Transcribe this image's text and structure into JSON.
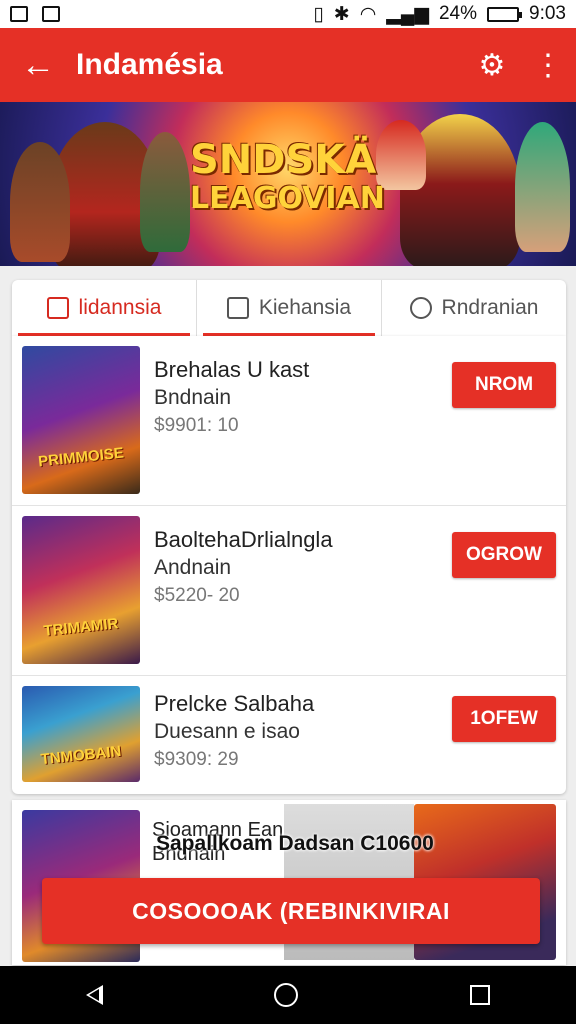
{
  "status_bar": {
    "battery": "24%",
    "time": "9:03"
  },
  "app_bar": {
    "title": "Indamésia"
  },
  "banner": {
    "title_line1": "SNDSKÄ",
    "title_line2": "LEAGOVIAN"
  },
  "tabs": [
    {
      "label": "lidannsia"
    },
    {
      "label": "Kiehansia"
    },
    {
      "label": "Rndranian"
    }
  ],
  "items": [
    {
      "name": "Brehalas U kast",
      "sub": "Bndnain",
      "price": "$9901: 10",
      "button": "NROM",
      "thumb_label": "PRIMMOISE"
    },
    {
      "name": "BaoltehaDrlialngla",
      "sub": "Andnain",
      "price": "$5220- 20",
      "button": "OGROW",
      "thumb_label": "TRIMAMIR"
    },
    {
      "name": "Prelcke Salbaha",
      "sub": "Duesann e isao",
      "price": "$9309: 29",
      "button": "1OFEW",
      "thumb_label": "TNMOBAIN"
    }
  ],
  "promo": {
    "name": "Sioamann Ean",
    "sub": "Bndhain",
    "overlay": "Sapallkoam Dadsan C10600"
  },
  "cta": {
    "label": "COSOOOAK  (REBINKIVIRAI"
  },
  "colors": {
    "primary": "#e53026",
    "background": "#eeeeee"
  }
}
